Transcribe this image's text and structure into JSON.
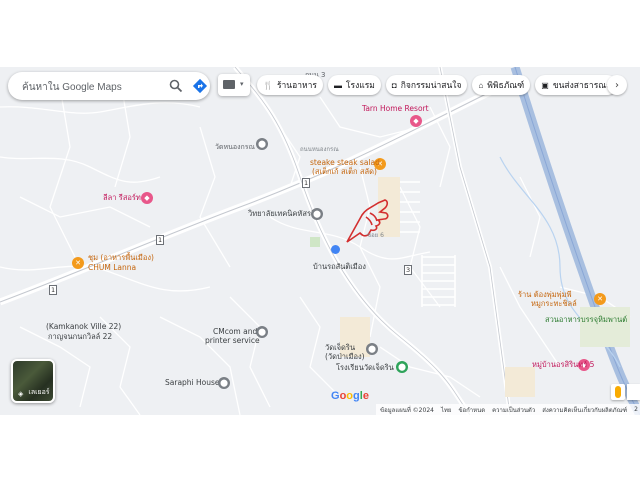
{
  "search": {
    "placeholder": "ค้นหาใน Google Maps"
  },
  "chips": [
    {
      "icon": "fork-knife-icon",
      "label": "ร้านอาหาร"
    },
    {
      "icon": "bed-icon",
      "label": "โรงแรม"
    },
    {
      "icon": "camera-icon",
      "label": "กิจกรรมน่าสนใจ"
    },
    {
      "icon": "museum-icon",
      "label": "พิพิธภัณฑ์"
    },
    {
      "icon": "bus-icon",
      "label": "ขนส่งสาธารณะ"
    }
  ],
  "places": {
    "tarn_home": "Tarn Home Resort",
    "steak_salad": "steake steak salad",
    "steak_salad_thai": "(สเต็กเก้ สเต็ก สลัด)",
    "wat_nong": "วัดหนองกรณ",
    "lila": "ลีลา รีสอร์ท",
    "wittaya": "วิทยาลัยเทคนิคหัสรถี",
    "chum_thai": "ชุม (อาหารพื้นเมือง)",
    "chum_lanna": "CHUM Lanna",
    "ban_san": "บ้านรถสันติเมือง",
    "kamkanok": "(Kamkanok Ville 22)",
    "kamkanok_thai": "กาญจนกนกวิลล์ 22",
    "cmcom_1": "CMcom and",
    "cmcom_2": "printer service",
    "wat_rong": "วัดเจ็ดริน",
    "wat_rong_2": "(วัดป่าเมือง)",
    "school": "โรงเรียนวัดเจ็ดริน",
    "saraphi": "Saraphi House",
    "dongpong_1": "ร้าน ต้องพุ่มพุ่มพี",
    "dongpong_2": "หมูกระทะชิลล์",
    "suan_aharn": "สวนอาหารบรรจุหิมพานต์",
    "mooban": "หมู่บ้านอรสิรินทร์ 5",
    "road_1": "ถนน 3",
    "road_2": "ถนนหนองกรณ",
    "road_3": "ซอย 6"
  },
  "route_shields": [
    "1",
    "1",
    "1",
    "3"
  ],
  "logo": "Google",
  "layers_label": "เลเยอร์",
  "footer": {
    "map_data": "ข้อมูลแผนที่ ©2024",
    "lang": "ไทย",
    "terms": "ข้อกำหนด",
    "privacy": "ความเป็นส่วนตัว",
    "feedback": "ส่งความคิดเห็นเกี่ยวกับผลิตภัณฑ์",
    "scale": "2"
  },
  "colors": {
    "highway": "#a8bfe0",
    "road": "#c4c8cf",
    "annotation": "#d32f2f"
  }
}
